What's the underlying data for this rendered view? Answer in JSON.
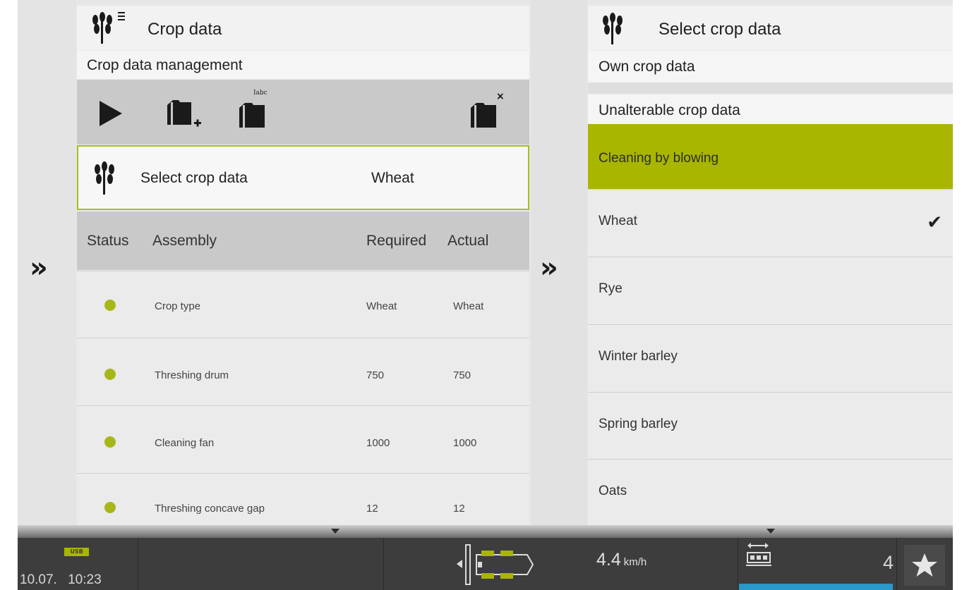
{
  "left_panel": {
    "title": "Crop data",
    "subtitle": "Crop data management",
    "toolbar": {
      "play_icon": "play-icon",
      "new_folder_icon": "folder-add-icon",
      "rename_icon": "folder-rename-icon",
      "rename_badge": "Iabc",
      "delete_icon": "folder-delete-icon",
      "delete_badge": "×"
    },
    "select_row": {
      "label": "Select crop data",
      "value": "Wheat"
    },
    "columns": {
      "status": "Status",
      "assembly": "Assembly",
      "required": "Required",
      "actual": "Actual"
    },
    "rows": [
      {
        "assembly": "Crop type",
        "required": "Wheat",
        "actual": "Wheat",
        "status_color": "#a7b71a"
      },
      {
        "assembly": "Threshing drum",
        "required": "750",
        "actual": "750",
        "status_color": "#a7b71a"
      },
      {
        "assembly": "Cleaning fan",
        "required": "1000",
        "actual": "1000",
        "status_color": "#a7b71a"
      },
      {
        "assembly": "Threshing concave gap",
        "required": "12",
        "actual": "12",
        "status_color": "#a7b71a"
      }
    ]
  },
  "right_panel": {
    "title": "Select crop data",
    "own_crop_data": "Own crop data",
    "unalterable_crop_data": "Unalterable crop data",
    "selected_item": "Cleaning by blowing",
    "options": [
      {
        "label": "Wheat",
        "checked": true
      },
      {
        "label": "Rye",
        "checked": false
      },
      {
        "label": "Winter barley",
        "checked": false
      },
      {
        "label": "Spring barley",
        "checked": false
      },
      {
        "label": "Oats",
        "checked": false
      }
    ]
  },
  "status_bar": {
    "usb_label": "USB",
    "date": "10.07.",
    "time": "10:23",
    "speed_value": "4.4",
    "speed_unit": "km/h",
    "count": "4"
  },
  "colors": {
    "accent_green": "#a8b600",
    "status_green": "#a7b71a",
    "status_bar": "#3d3d3d",
    "blue_indicator": "#2a98c8"
  }
}
